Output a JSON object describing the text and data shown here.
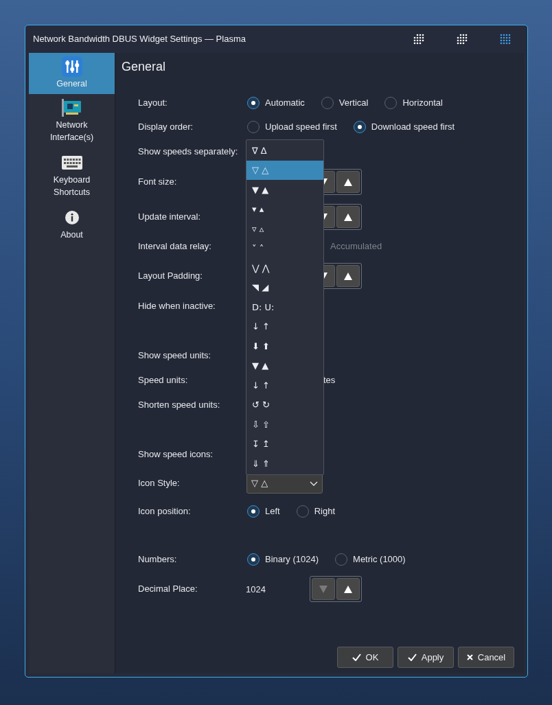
{
  "window": {
    "title": "Network Bandwidth DBUS Widget Settings — Plasma"
  },
  "sidebar": {
    "items": [
      {
        "label": "General",
        "selected": true
      },
      {
        "label": "Network Interface(s)",
        "selected": false
      },
      {
        "label": "Keyboard Shortcuts",
        "selected": false
      },
      {
        "label": "About",
        "selected": false
      }
    ]
  },
  "page": {
    "title": "General"
  },
  "form": [
    {
      "label": "Layout:",
      "kind": "radio",
      "options": [
        {
          "label": "Automatic",
          "selected": true
        },
        {
          "label": "Vertical",
          "selected": false
        },
        {
          "label": "Horizontal",
          "selected": false
        }
      ]
    },
    {
      "label": "Display order:",
      "kind": "radio",
      "options": [
        {
          "label": "Upload speed first",
          "selected": false
        },
        {
          "label": "Download speed first",
          "selected": true
        }
      ]
    },
    {
      "label": "Show speeds separately:",
      "kind": "hidden"
    },
    {
      "label": "Font size:",
      "kind": "spin"
    },
    {
      "label": "Update interval:",
      "kind": "spin"
    },
    {
      "label": "Interval data relay:",
      "kind": "partial_radio",
      "text": "Accumulated",
      "disabled": true
    },
    {
      "label": "Layout Padding:",
      "kind": "spin"
    },
    {
      "label": "Hide when inactive:",
      "kind": "hidden"
    },
    {
      "label": "Show speed units:",
      "kind": "hidden"
    },
    {
      "label": "Speed units:",
      "kind": "partial_text",
      "text": "tes",
      "disabled": false
    },
    {
      "label": "Shorten speed units:",
      "kind": "hidden"
    },
    {
      "label": "Show speed icons:",
      "kind": "hidden"
    },
    {
      "label": "Icon Style:",
      "kind": "combo",
      "value": "▽ △"
    },
    {
      "label": "Icon position:",
      "kind": "radio",
      "options": [
        {
          "label": "Left",
          "selected": true
        },
        {
          "label": "Right",
          "selected": false
        }
      ]
    },
    {
      "label": "Numbers:",
      "kind": "radio",
      "options": [
        {
          "label": "Binary (1024)",
          "selected": true
        },
        {
          "label": "Metric (1000)",
          "selected": false
        }
      ]
    },
    {
      "label": "Decimal Place:",
      "kind": "spin",
      "value": "1024",
      "down_disabled": true
    }
  ],
  "dropdown": {
    "items": [
      {
        "label": "∇ ∆",
        "selected": false
      },
      {
        "label": "▽ △",
        "selected": true
      },
      {
        "label": "▼ ▲",
        "selected": false
      },
      {
        "label": "▾ ▴",
        "selected": false
      },
      {
        "label": "▿ ▵",
        "selected": false
      },
      {
        "label": "˅ ˄",
        "selected": false
      },
      {
        "label": "⋁ ⋀",
        "selected": false
      },
      {
        "label": "◥ ◢",
        "selected": false
      },
      {
        "label": "D: U:",
        "selected": false
      },
      {
        "label": "↓ ↑",
        "selected": false
      },
      {
        "label": "⬇ ⬆",
        "selected": false
      },
      {
        "label": "▼ ▲",
        "selected": false
      },
      {
        "label": "↓ ↑",
        "selected": false
      },
      {
        "label": "↺ ↻",
        "selected": false
      },
      {
        "label": "⇩ ⇧",
        "selected": false
      },
      {
        "label": "↧ ↥",
        "selected": false
      },
      {
        "label": "⇓ ⇑",
        "selected": false
      }
    ]
  },
  "buttons": [
    {
      "label": "OK"
    },
    {
      "label": "Apply"
    },
    {
      "label": "Cancel"
    }
  ]
}
